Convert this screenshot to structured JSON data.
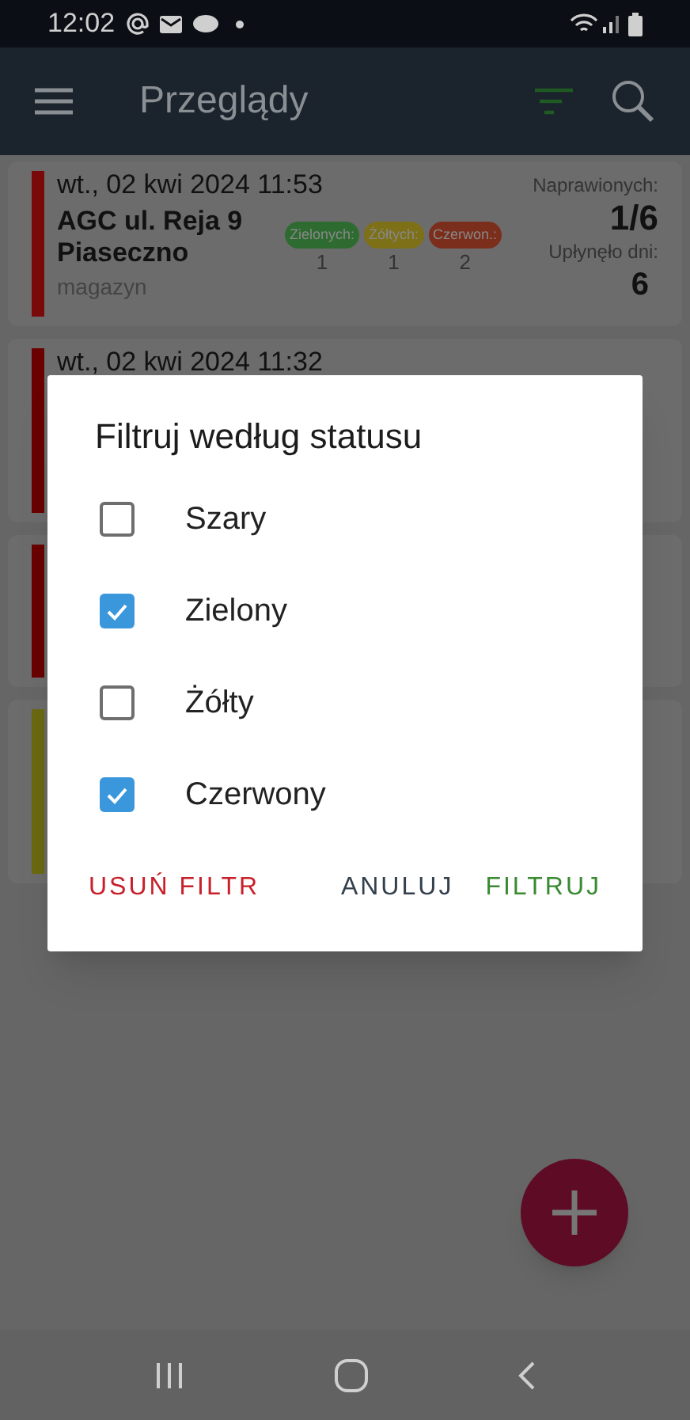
{
  "status_bar": {
    "time": "12:02"
  },
  "app_bar": {
    "title": "Przeglądy",
    "filter_active": true
  },
  "cards": [
    {
      "color": "#7a0a0a",
      "date": "wt., 02 kwi 2024 11:53",
      "name": "AGC ul. Reja 9 Piaseczno",
      "category": "magazyn",
      "badges": [
        {
          "label": "Zielonych:",
          "count": "1",
          "color": "#2e6b30"
        },
        {
          "label": "Żółtych:",
          "count": "1",
          "color": "#7d7016"
        },
        {
          "label": "Czerwon.:",
          "count": "2",
          "color": "#7c2e1c"
        }
      ],
      "repaired_label": "Naprawionych:",
      "repaired": "1/6",
      "days_label": "Upłynęło dni:",
      "days": "6"
    },
    {
      "color": "#6a0000",
      "date": "wt., 02 kwi 2024 11:32"
    },
    {
      "color": "#6a0000"
    },
    {
      "color": "#6b6a12"
    }
  ],
  "dialog": {
    "title": "Filtruj według statusu",
    "options": [
      {
        "label": "Szary",
        "checked": false
      },
      {
        "label": "Zielony",
        "checked": true
      },
      {
        "label": "Żółty",
        "checked": false
      },
      {
        "label": "Czerwony",
        "checked": true
      }
    ],
    "buttons": [
      {
        "label": "USUŃ FILTR",
        "kind": "danger"
      },
      {
        "label": "ANULUJ",
        "kind": "neutral"
      },
      {
        "label": "FILTRUJ",
        "kind": "primary"
      }
    ]
  }
}
